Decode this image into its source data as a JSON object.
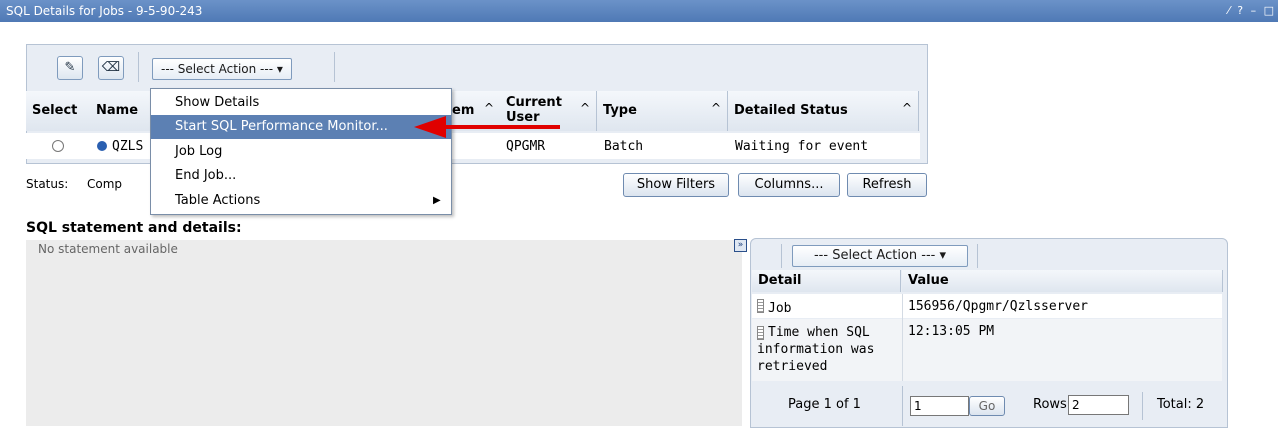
{
  "window": {
    "title": "SQL Details for Jobs - 9-5-90-243",
    "controls": "⁄ ? – □"
  },
  "toolbar": {
    "select_action": "--- Select Action --- ▾",
    "icon1": "edit-icon",
    "icon2": "erase-icon"
  },
  "table": {
    "headers": [
      "Select",
      "Name",
      "em",
      "Current User",
      "Type",
      "Detailed Status"
    ],
    "sort_arrow": "^",
    "row": {
      "name": "QZLS",
      "user": "QPGMR",
      "type": "Batch",
      "status": "Waiting for event"
    }
  },
  "menu": {
    "items": [
      "Show Details",
      "Start SQL Performance Monitor...",
      "Job Log",
      "End Job...",
      "Table Actions"
    ],
    "submenu_arrow": "▶"
  },
  "status": {
    "label": "Status:",
    "value": "Comp"
  },
  "buttons": {
    "show_filters": "Show Filters",
    "columns": "Columns...",
    "refresh": "Refresh"
  },
  "sql_section": {
    "heading": "SQL statement and details:",
    "empty_text": "No statement available"
  },
  "details": {
    "expand_icon": "»",
    "select_action": "--- Select Action --- ▾",
    "headers": [
      "Detail",
      "Value"
    ],
    "rows": [
      {
        "detail": "Job",
        "value": "156956/Qpgmr/Qzlsserver"
      },
      {
        "detail": "Time when SQL information was retrieved",
        "value": "12:13:05 PM"
      }
    ],
    "pager": {
      "page": "Page 1 of 1",
      "page_input": "1",
      "go": "Go",
      "rows_label": "Rows",
      "rows_input": "2",
      "total": "Total: 2"
    }
  },
  "colors": {
    "accent": "#5c80b3",
    "arrow": "#e00000"
  }
}
